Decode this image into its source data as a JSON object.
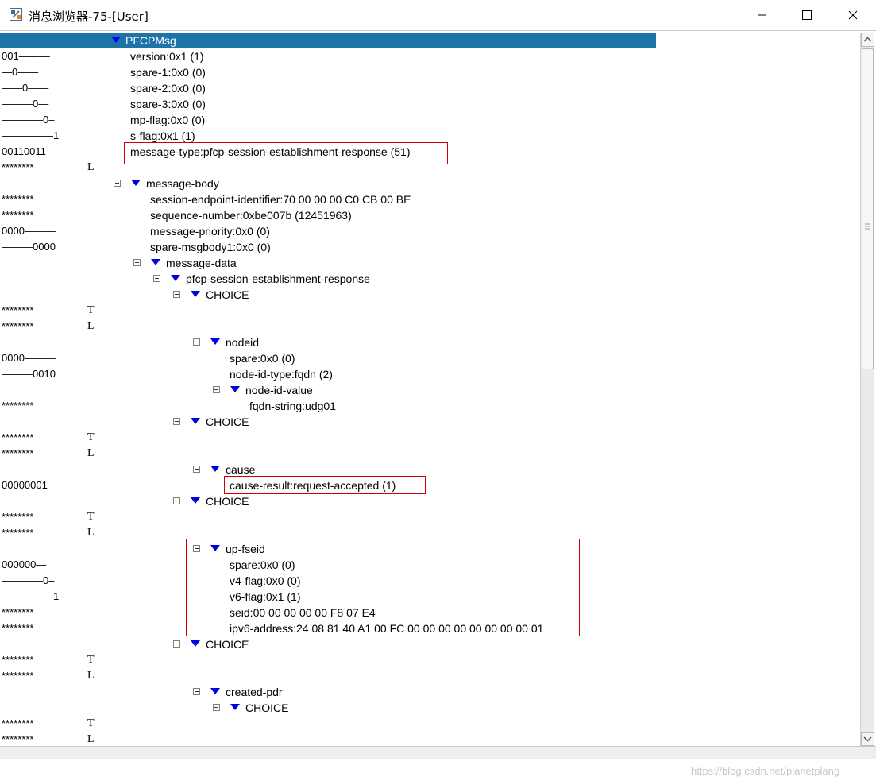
{
  "window": {
    "title": "消息浏览器-75-[User]",
    "icon": "message-browser-icon",
    "controls": [
      "minimize-icon",
      "maximize-icon",
      "close-icon"
    ]
  },
  "tree": {
    "root_label": "PFCPMsg",
    "rows": [
      {
        "bits": "001———",
        "tl": "",
        "label": "version:0x1 (1)",
        "depth": 1,
        "node": false
      },
      {
        "bits": "—0——",
        "tl": "",
        "label": "spare-1:0x0 (0)",
        "depth": 1,
        "node": false
      },
      {
        "bits": "——0——",
        "tl": "",
        "label": "spare-2:0x0 (0)",
        "depth": 1,
        "node": false
      },
      {
        "bits": "———0—",
        "tl": "",
        "label": "spare-3:0x0 (0)",
        "depth": 1,
        "node": false
      },
      {
        "bits": "————0–",
        "tl": "",
        "label": "mp-flag:0x0 (0)",
        "depth": 1,
        "node": false
      },
      {
        "bits": "—————1",
        "tl": "",
        "label": "s-flag:0x1 (1)",
        "depth": 1,
        "node": false
      },
      {
        "bits": "00110011",
        "tl": "",
        "label": "message-type:pfcp-session-establishment-response (51)",
        "depth": 1,
        "node": false
      },
      {
        "bits": "********",
        "tl": "L",
        "label": "",
        "depth": 1,
        "node": false
      },
      {
        "bits": "",
        "tl": "",
        "label": "message-body",
        "depth": 1,
        "node": true
      },
      {
        "bits": "********",
        "tl": "",
        "label": "session-endpoint-identifier:70 00 00 00 C0 CB 00 BE",
        "depth": 2,
        "node": false
      },
      {
        "bits": "********",
        "tl": "",
        "label": "sequence-number:0xbe007b (12451963)",
        "depth": 2,
        "node": false
      },
      {
        "bits": "0000———",
        "tl": "",
        "label": "message-priority:0x0 (0)",
        "depth": 2,
        "node": false
      },
      {
        "bits": "———0000",
        "tl": "",
        "label": "spare-msgbody1:0x0 (0)",
        "depth": 2,
        "node": false
      },
      {
        "bits": "",
        "tl": "",
        "label": "message-data",
        "depth": 2,
        "node": true
      },
      {
        "bits": "",
        "tl": "",
        "label": "pfcp-session-establishment-response",
        "depth": 3,
        "node": true
      },
      {
        "bits": "",
        "tl": "",
        "label": "CHOICE",
        "depth": 4,
        "node": true
      },
      {
        "bits": "********",
        "tl": "T",
        "label": "",
        "depth": 5,
        "node": false
      },
      {
        "bits": "********",
        "tl": "L",
        "label": "",
        "depth": 5,
        "node": false
      },
      {
        "bits": "",
        "tl": "",
        "label": "nodeid",
        "depth": 5,
        "node": true
      },
      {
        "bits": "0000———",
        "tl": "",
        "label": "spare:0x0 (0)",
        "depth": 6,
        "node": false
      },
      {
        "bits": "———0010",
        "tl": "",
        "label": "node-id-type:fqdn (2)",
        "depth": 6,
        "node": false
      },
      {
        "bits": "",
        "tl": "",
        "label": "node-id-value",
        "depth": 6,
        "node": true
      },
      {
        "bits": "********",
        "tl": "",
        "label": "fqdn-string:udg01",
        "depth": 7,
        "node": false
      },
      {
        "bits": "",
        "tl": "",
        "label": "CHOICE",
        "depth": 4,
        "node": true
      },
      {
        "bits": "********",
        "tl": "T",
        "label": "",
        "depth": 5,
        "node": false
      },
      {
        "bits": "********",
        "tl": "L",
        "label": "",
        "depth": 5,
        "node": false
      },
      {
        "bits": "",
        "tl": "",
        "label": "cause",
        "depth": 5,
        "node": true
      },
      {
        "bits": "00000001",
        "tl": "",
        "label": "cause-result:request-accepted (1)",
        "depth": 6,
        "node": false
      },
      {
        "bits": "",
        "tl": "",
        "label": "CHOICE",
        "depth": 4,
        "node": true
      },
      {
        "bits": "********",
        "tl": "T",
        "label": "",
        "depth": 5,
        "node": false
      },
      {
        "bits": "********",
        "tl": "L",
        "label": "",
        "depth": 5,
        "node": false
      },
      {
        "bits": "",
        "tl": "",
        "label": "up-fseid",
        "depth": 5,
        "node": true
      },
      {
        "bits": "000000—",
        "tl": "",
        "label": "spare:0x0 (0)",
        "depth": 6,
        "node": false
      },
      {
        "bits": "————0–",
        "tl": "",
        "label": "v4-flag:0x0 (0)",
        "depth": 6,
        "node": false
      },
      {
        "bits": "—————1",
        "tl": "",
        "label": "v6-flag:0x1 (1)",
        "depth": 6,
        "node": false
      },
      {
        "bits": "********",
        "tl": "",
        "label": "seid:00 00 00 00 00 F8 07 E4",
        "depth": 6,
        "node": false
      },
      {
        "bits": "********",
        "tl": "",
        "label": "ipv6-address:24 08 81 40 A1 00 FC 00 00 00 00 00 00 00 00 01",
        "depth": 6,
        "node": false
      },
      {
        "bits": "",
        "tl": "",
        "label": "CHOICE",
        "depth": 4,
        "node": true
      },
      {
        "bits": "********",
        "tl": "T",
        "label": "",
        "depth": 5,
        "node": false
      },
      {
        "bits": "********",
        "tl": "L",
        "label": "",
        "depth": 5,
        "node": false
      },
      {
        "bits": "",
        "tl": "",
        "label": "created-pdr",
        "depth": 5,
        "node": true
      },
      {
        "bits": "",
        "tl": "",
        "label": "CHOICE",
        "depth": 6,
        "node": true
      },
      {
        "bits": "********",
        "tl": "T",
        "label": "",
        "depth": 7,
        "node": false
      },
      {
        "bits": "********",
        "tl": "L",
        "label": "",
        "depth": 7,
        "node": false
      }
    ]
  },
  "watermark": "https://blog.csdn.net/planetplang",
  "colors": {
    "selection": "#1e73a8",
    "triangle": "#0000e0",
    "highlight_box": "#d40000"
  }
}
